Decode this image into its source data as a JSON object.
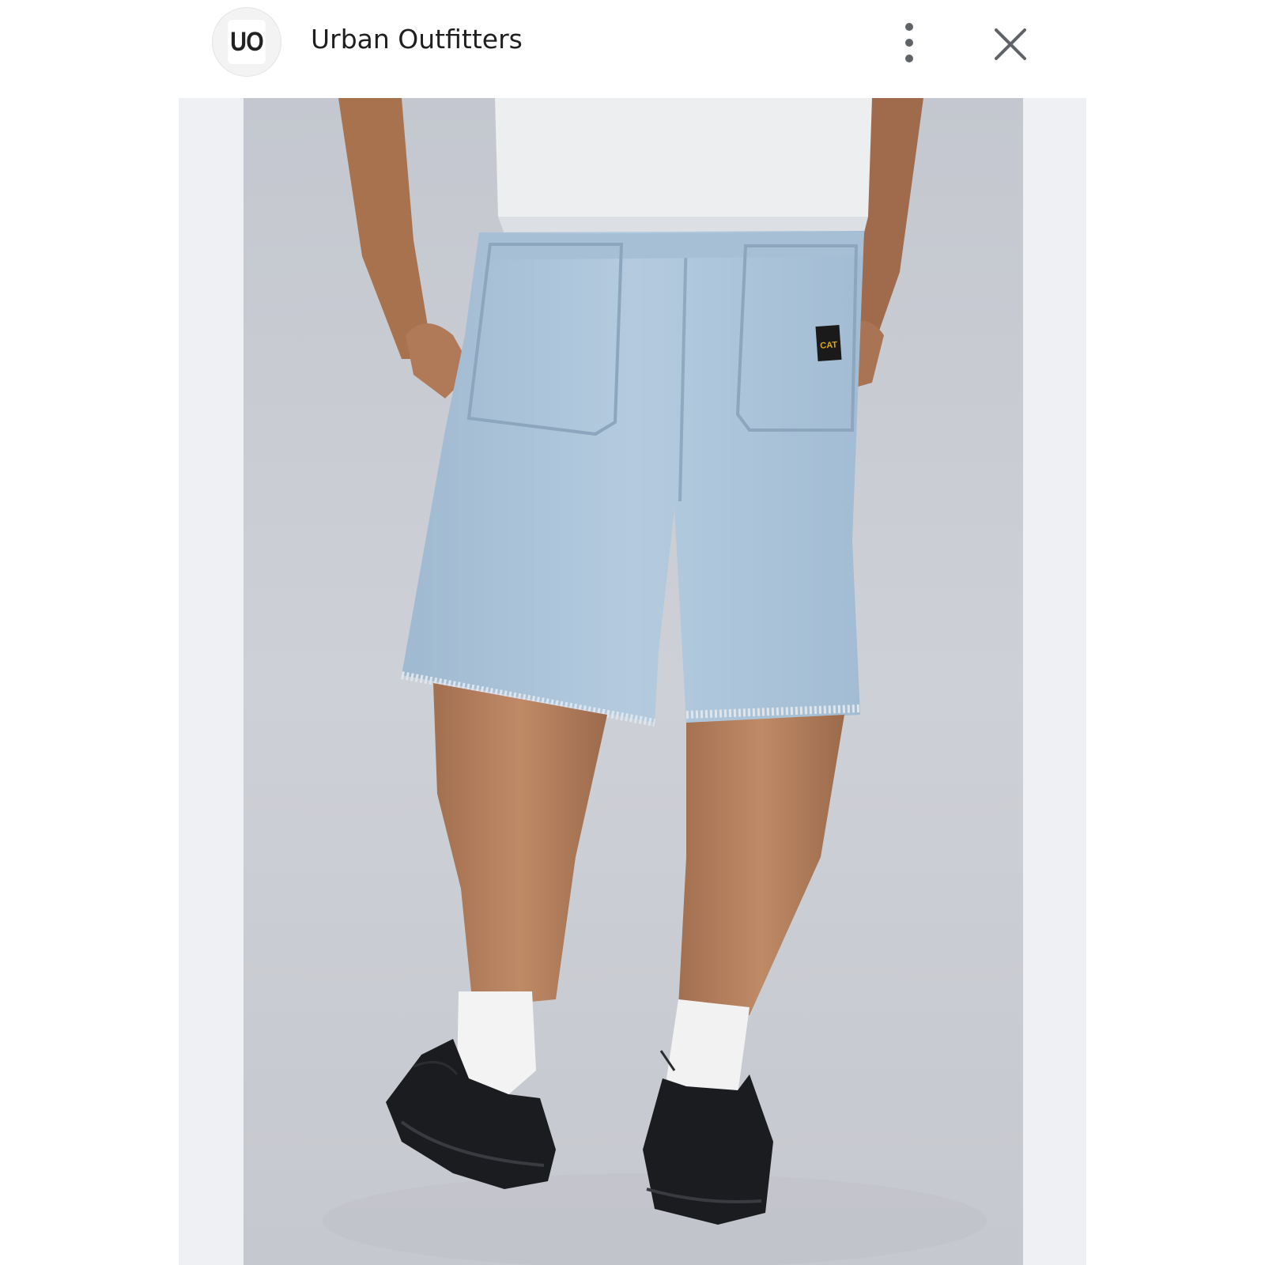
{
  "header": {
    "logo_text": "UO",
    "title": "Urban Outfitters",
    "more_icon": "more-vertical-icon",
    "close_icon": "close-icon"
  },
  "image": {
    "label_text": "CAT"
  },
  "colors": {
    "backdrop": "#c9ccd3",
    "denim": "#a9c3d9",
    "shirt": "#eceef0",
    "skin": "#b07a58",
    "sock": "#f3f3f3",
    "shoe": "#1b1c1f",
    "label_bg": "#1a1a1a",
    "label_text": "#e0a81c"
  }
}
